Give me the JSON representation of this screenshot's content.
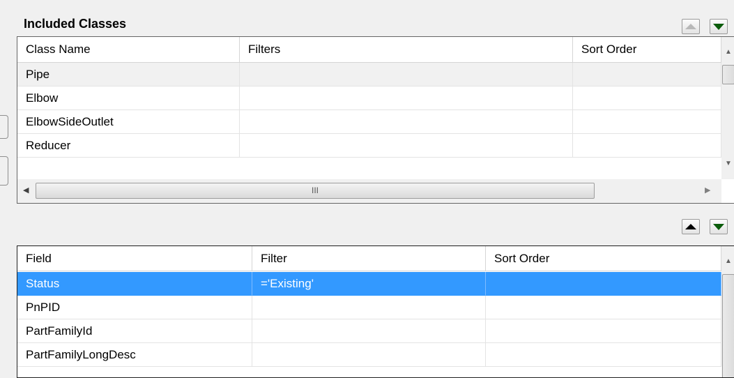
{
  "classes_panel": {
    "title": "Included Classes",
    "columns": [
      "Class Name",
      "Filters",
      "Sort Order"
    ],
    "rows": [
      {
        "name": "Pipe",
        "filter": "",
        "sort": ""
      },
      {
        "name": "Elbow",
        "filter": "",
        "sort": ""
      },
      {
        "name": "ElbowSideOutlet",
        "filter": "",
        "sort": ""
      },
      {
        "name": "Reducer",
        "filter": "",
        "sort": ""
      }
    ],
    "hscroll_grip": "III"
  },
  "fields_panel": {
    "columns": [
      "Field",
      "Filter",
      "Sort Order"
    ],
    "rows": [
      {
        "name": "Status",
        "filter": "='Existing'",
        "sort": ""
      },
      {
        "name": "PnPID",
        "filter": "",
        "sort": ""
      },
      {
        "name": "PartFamilyId",
        "filter": "",
        "sort": ""
      },
      {
        "name": "PartFamilyLongDesc",
        "filter": "",
        "sort": ""
      }
    ]
  },
  "icons": {
    "move_up": "triangle-up-icon",
    "move_down": "triangle-down-icon"
  },
  "colors": {
    "selection": "#3399ff",
    "down_arrow": "#0b5c0b"
  }
}
